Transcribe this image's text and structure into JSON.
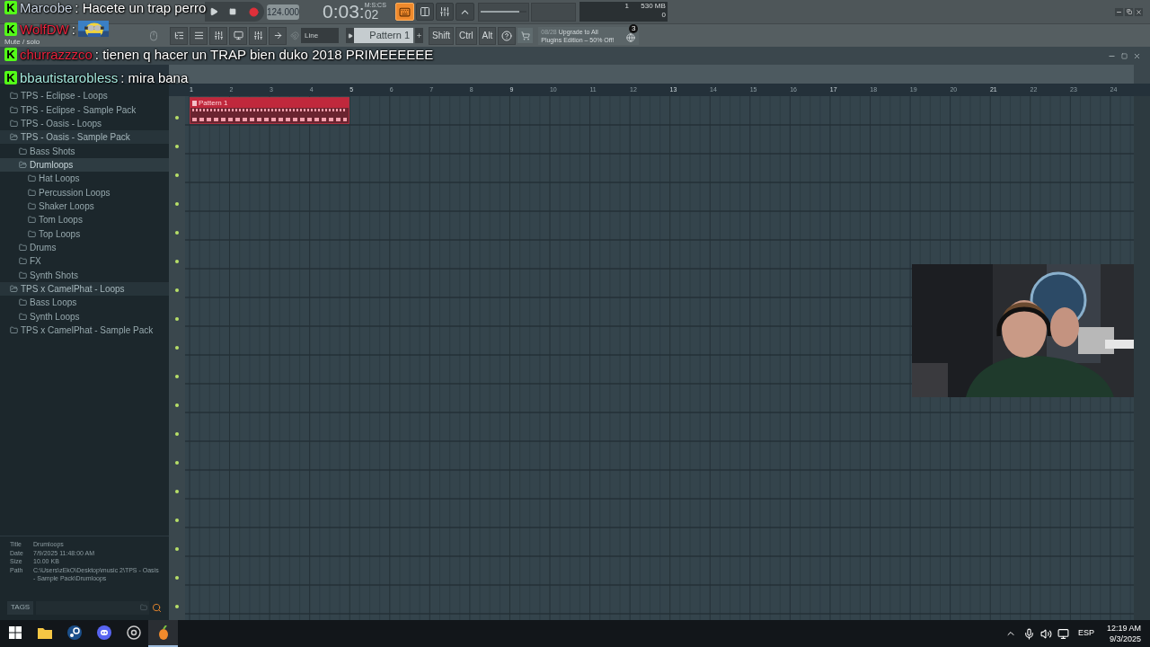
{
  "chat": [
    {
      "badge": "K",
      "user": "Marcobe",
      "color": "#c9d4e2",
      "message": ": Hacete un trap perro"
    },
    {
      "badge": "K",
      "user": "WolfDW",
      "color": "#e8243e",
      "message": ":",
      "kind": "picture"
    },
    {
      "badge": "K",
      "user": "churrazzzco",
      "color": "#e8243e",
      "message": ": tienen q hacer un TRAP bien duko 2018 PRIMEEEEEE"
    },
    {
      "badge": "K",
      "user": "bbautistarobless",
      "color": "#a6eadf",
      "message": ": mira bana"
    }
  ],
  "hint": "Mute / solo",
  "transport": {
    "tempo": "124.000",
    "time": "0:03:",
    "time_cs": "02",
    "time_unit": "M:S:CS"
  },
  "toggles": [
    {
      "on": true
    },
    {
      "on": false
    },
    {
      "on": false
    },
    {
      "on": false
    }
  ],
  "master_volume": {
    "level": 0.85
  },
  "monitor": {
    "cpu": "1",
    "memory": "530 MB",
    "polyphony": "0"
  },
  "toolbar": {
    "snap": "Line",
    "pattern": "Pattern 1",
    "modifiers": [
      "Shift",
      "Ctrl",
      "Alt"
    ],
    "news": {
      "date": "08/28",
      "text_1": "Upgrade to All",
      "text_2": "Plugins Edition – 50% Off!",
      "count": "3"
    }
  },
  "browser": {
    "items": [
      {
        "label": "TPS - Eclipse - Loops",
        "expanded": false,
        "selected": false
      },
      {
        "label": "TPS - Eclipse - Sample Pack",
        "expanded": false,
        "selected": false
      },
      {
        "label": "TPS - Oasis - Loops",
        "expanded": false,
        "selected": false
      },
      {
        "label": "TPS - Oasis - Sample Pack",
        "expanded": true,
        "selected": false,
        "children": [
          {
            "label": "Bass Shots",
            "expanded": false,
            "selected": false
          },
          {
            "label": "Drumloops",
            "expanded": true,
            "selected": true,
            "children": [
              {
                "label": "Hat Loops",
                "expanded": false,
                "selected": false
              },
              {
                "label": "Percussion Loops",
                "expanded": false,
                "selected": false
              },
              {
                "label": "Shaker Loops",
                "expanded": false,
                "selected": false
              },
              {
                "label": "Tom Loops",
                "expanded": false,
                "selected": false
              },
              {
                "label": "Top Loops",
                "expanded": false,
                "selected": false
              }
            ]
          },
          {
            "label": "Drums",
            "expanded": false,
            "selected": false
          },
          {
            "label": "FX",
            "expanded": false,
            "selected": false
          },
          {
            "label": "Synth Shots",
            "expanded": false,
            "selected": false
          }
        ]
      },
      {
        "label": "TPS x CamelPhat - Loops",
        "expanded": true,
        "selected": false,
        "children": [
          {
            "label": "Bass Loops",
            "expanded": false,
            "selected": false
          },
          {
            "label": "Synth Loops",
            "expanded": false,
            "selected": false
          }
        ]
      },
      {
        "label": "TPS x CamelPhat - Sample Pack",
        "expanded": false,
        "selected": false
      }
    ],
    "info": [
      {
        "label": "Title",
        "value": "Drumloops"
      },
      {
        "label": "Date",
        "value": "7/9/2025 11:48:00 AM"
      },
      {
        "label": "Size",
        "value": "10.00 KB"
      },
      {
        "label": "Path",
        "value": "C:\\Users\\zEkO\\Desktop\\music 2\\TPS - Oasis - Sample Pack\\Drumloops"
      }
    ],
    "tags_label": "TAGS"
  },
  "playlist": {
    "ruler": [
      "1",
      "2",
      "3",
      "4",
      "5",
      "6",
      "7",
      "8",
      "9",
      "10",
      "11",
      "12",
      "13",
      "14",
      "15",
      "16",
      "17",
      "18",
      "19",
      "20",
      "21",
      "22",
      "23",
      "24"
    ],
    "clip": {
      "label": "Pattern 1"
    }
  },
  "taskbar": {
    "apps": [
      {
        "kind": "start",
        "selected": false
      },
      {
        "kind": "folder",
        "selected": false
      },
      {
        "kind": "steam",
        "selected": false
      },
      {
        "kind": "discord",
        "selected": false
      },
      {
        "kind": "chrome",
        "selected": false
      },
      {
        "kind": "fl",
        "selected": true
      }
    ],
    "language": "ESP",
    "time": "12:19 AM",
    "date": "9/3/2025"
  }
}
